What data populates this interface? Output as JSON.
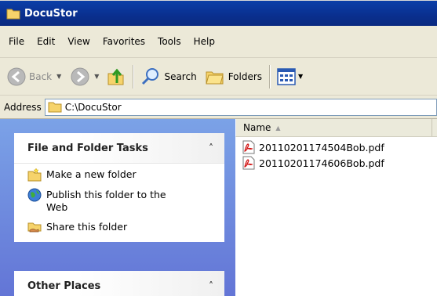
{
  "window": {
    "title": "DocuStor"
  },
  "menu": [
    "File",
    "Edit",
    "View",
    "Favorites",
    "Tools",
    "Help"
  ],
  "toolbar": {
    "back_label": "Back",
    "search_label": "Search",
    "folders_label": "Folders"
  },
  "address": {
    "label": "Address",
    "path": "C:\\DocuStor"
  },
  "tasks_panel": {
    "title": "File and Folder Tasks",
    "collapse_glyph": "˄",
    "items": [
      {
        "label": "Make a new folder",
        "icon": "new-folder-icon"
      },
      {
        "label": "Publish this folder to the Web",
        "icon": "globe-icon"
      },
      {
        "label": "Share this folder",
        "icon": "share-folder-icon"
      }
    ]
  },
  "other_places_panel": {
    "title": "Other Places",
    "collapse_glyph": "˄"
  },
  "file_list": {
    "column_name": "Name",
    "sort_glyph": "▲",
    "files": [
      {
        "name": "20110201174504Bob.pdf",
        "icon": "pdf-icon"
      },
      {
        "name": "20110201174606Bob.pdf",
        "icon": "pdf-icon"
      }
    ]
  },
  "colors": {
    "title_bar": "#0a3fa8",
    "chrome": "#ece9d8",
    "task_pane": "#6f8fdf"
  }
}
